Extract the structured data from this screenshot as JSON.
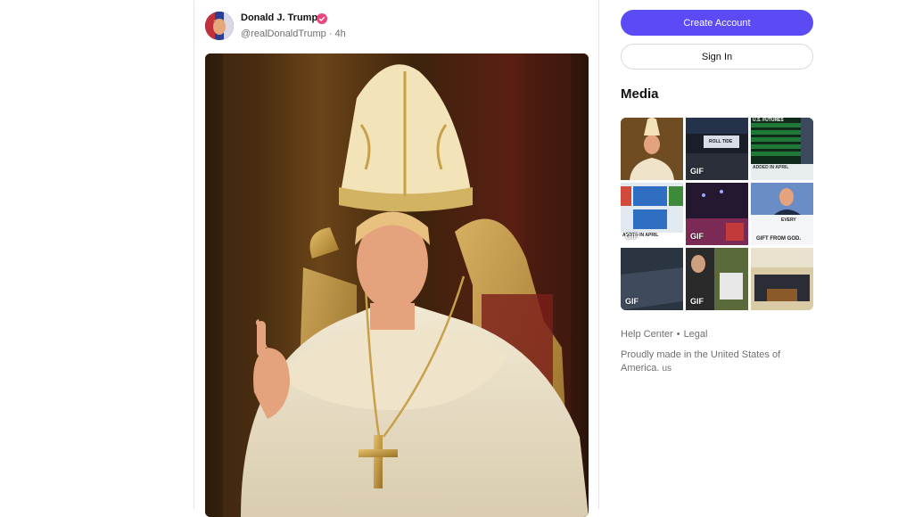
{
  "post": {
    "display_name": "Donald J. Trump",
    "handle": "@realDonaldTrump",
    "separator": "·",
    "time": "4h"
  },
  "sidebar": {
    "create_account_label": "Create Account",
    "sign_in_label": "Sign In",
    "media_title": "Media",
    "media_tiles": [
      {
        "gif": ""
      },
      {
        "gif": "GIF",
        "caption": "ROLL TIDE"
      },
      {
        "gif": "",
        "caption": "U.S. FUTURES",
        "caption2": "ADDED IN APRIL"
      },
      {
        "gif": "GIF",
        "caption": "ADDED IN APRIL"
      },
      {
        "gif": "GIF"
      },
      {
        "gif": "",
        "caption": "EVERY",
        "caption2": "GIFT FROM GOD."
      },
      {
        "gif": "GIF"
      },
      {
        "gif": "GIF"
      },
      {
        "gif": ""
      }
    ],
    "footer": {
      "help_center": "Help Center",
      "bullet": "•",
      "legal": "Legal",
      "made_in": "Proudly made in the United States of America.",
      "flag": "us"
    }
  },
  "colors": {
    "accent": "#5b4bf5",
    "verified": "#e8467c",
    "muted_text": "#6f6f6f"
  }
}
